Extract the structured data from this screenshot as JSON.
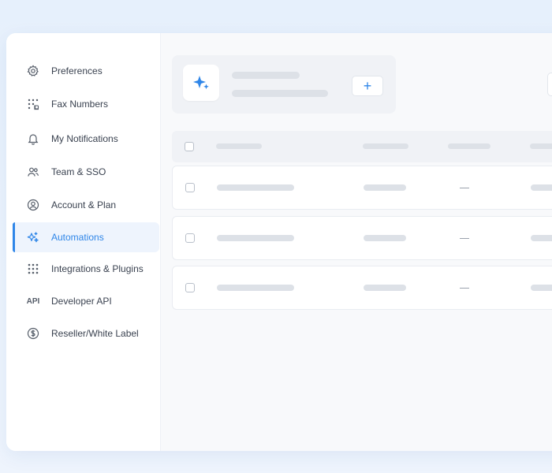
{
  "sidebar": {
    "items": [
      {
        "label": "Preferences",
        "icon": "gear-icon",
        "active": false
      },
      {
        "label": "Fax Numbers",
        "icon": "dialpad-icon",
        "active": false
      },
      {
        "label": "My Notifications",
        "icon": "bell-icon",
        "active": false
      },
      {
        "label": "Team & SSO",
        "icon": "users-icon",
        "active": false
      },
      {
        "label": "Account & Plan",
        "icon": "user-circle-icon",
        "active": false
      },
      {
        "label": "Automations",
        "icon": "sparkles-icon",
        "active": true
      },
      {
        "label": "Integrations & Plugins",
        "icon": "grid-dots-icon",
        "active": false
      },
      {
        "label": "Developer API",
        "icon": "api-text-icon",
        "active": false
      },
      {
        "label": "Reseller/White Label",
        "icon": "dollar-circle-icon",
        "active": false
      }
    ],
    "api_icon_text": "API"
  },
  "colors": {
    "accent": "#2f86e8",
    "text": "#3a4250",
    "skeleton": "#dde1e7"
  },
  "header": {
    "icon": "sparkle-icon",
    "add_label": "+"
  },
  "table": {
    "rows": [
      {
        "placeholder_value": "—"
      },
      {
        "placeholder_value": "—"
      },
      {
        "placeholder_value": "—"
      }
    ]
  }
}
